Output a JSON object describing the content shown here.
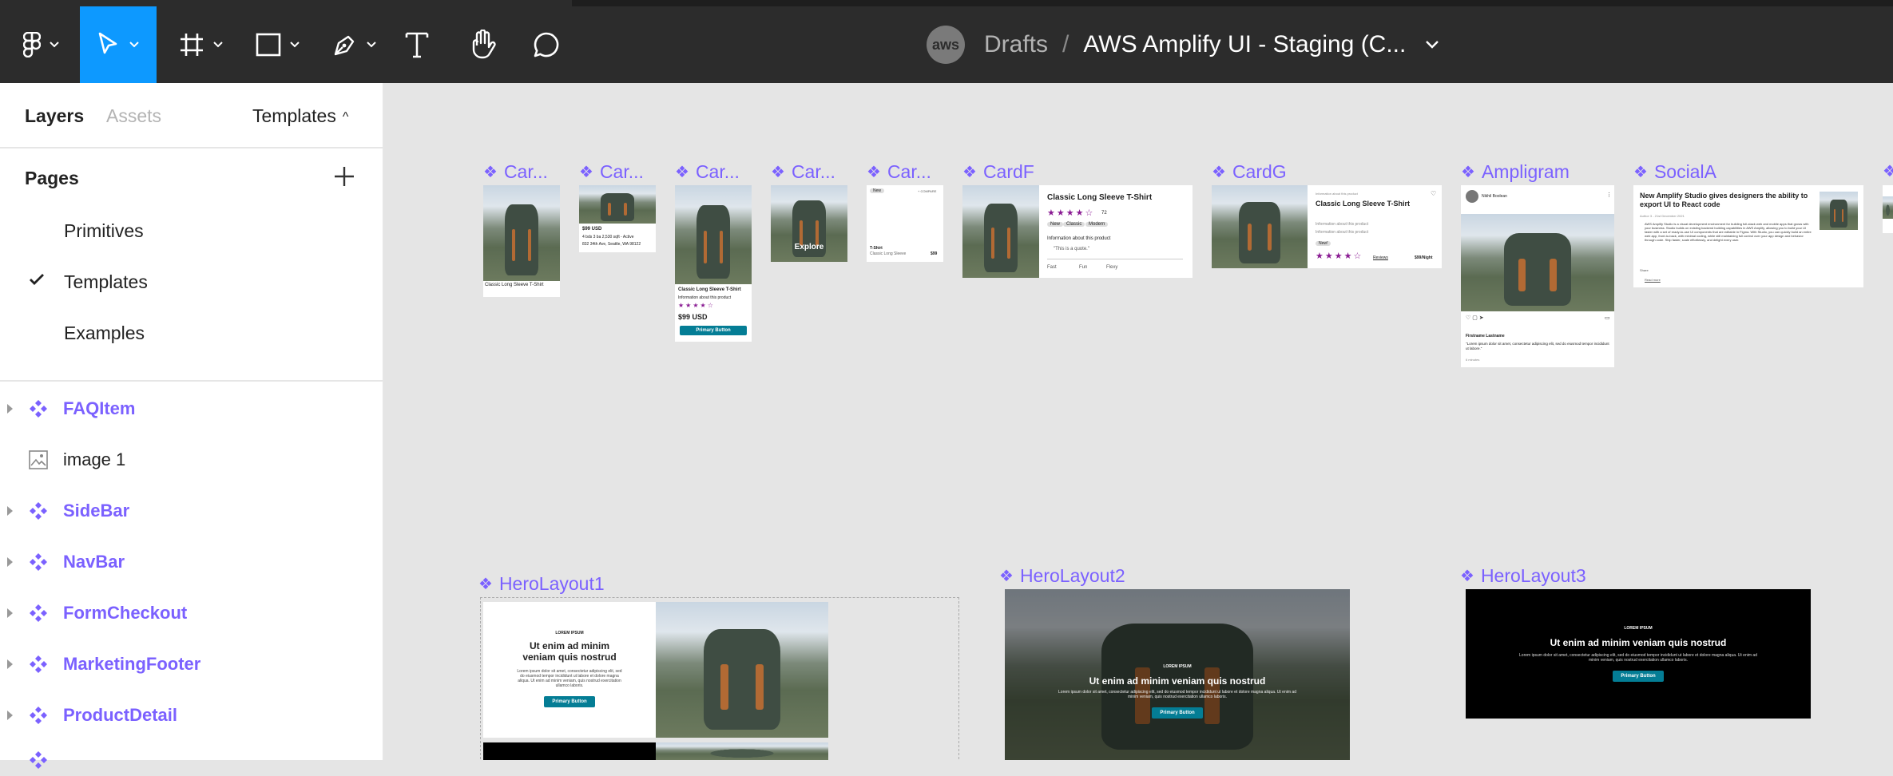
{
  "toolbar": {
    "breadcrumb": {
      "avatar": "aws",
      "project": "Drafts",
      "separator": "/",
      "file": "AWS Amplify UI - Staging (C..."
    }
  },
  "left_panel": {
    "tabs": {
      "layers": "Layers",
      "assets": "Assets",
      "templates": "Templates"
    },
    "pages_header": "Pages",
    "pages": [
      {
        "label": "Primitives"
      },
      {
        "label": "Templates"
      },
      {
        "label": "Examples"
      }
    ],
    "layers": [
      {
        "label": "FAQItem"
      },
      {
        "label": "image 1"
      },
      {
        "label": "SideBar"
      },
      {
        "label": "NavBar"
      },
      {
        "label": "FormCheckout"
      },
      {
        "label": "MarketingFooter"
      },
      {
        "label": "ProductDetail"
      }
    ]
  },
  "canvas": {
    "frame_labels": [
      "Car...",
      "Car...",
      "Car...",
      "Car...",
      "Car...",
      "CardF",
      "CardG",
      "Ampligram",
      "SocialA",
      "HeroLayout1",
      "HeroLayout2",
      "HeroLayout3"
    ],
    "cards": {
      "card_a_title": "Classic Long Sleeve T-Shirt",
      "card_b_price": "$99 USD",
      "card_b_line1": "4 bds 3 ba 2,530 sqft - Active",
      "card_b_line2": "832 34th Ave, Seattle, WA 98122",
      "card_c_title": "Classic Long Sleeve T-Shirt",
      "card_c_info": "Information about this product",
      "card_c_stars": "★★★★☆",
      "card_c_price": "$99 USD",
      "card_c_button": "Primary Button",
      "card_d_button": "Explore",
      "card_e_badge": "New",
      "card_e_compare": "+ COMPARE",
      "card_e_name": "T-Shirt",
      "card_e_sub": "Classic Long Sleeve",
      "card_e_price": "$99",
      "cardf_title": "Classic Long Sleeve T-Shirt",
      "cardf_stars": "★★★★☆",
      "cardf_count": "72",
      "cardf_badges": [
        "New",
        "Classic",
        "Modern"
      ],
      "cardf_info": "Information about this product",
      "cardf_quote": "\"This is a quote.\"",
      "cardf_features": [
        "Fast",
        "Fun",
        "Flexy"
      ],
      "cardg_caption": "Information about this product",
      "cardg_title": "Classic Long Sleeve T-Shirt",
      "cardg_info1": "Information about this product",
      "cardg_info2": "Information about this product",
      "cardg_badge": "New!",
      "cardg_stars": "★★★★☆",
      "cardg_reviews": "Reviews",
      "cardg_price": "$99/Night",
      "ampligram_user": "Nikhil Boolean",
      "ampligram_author": "Firstname Lastname",
      "ampligram_body": "\"Lorem ipsum dolor sit amet, consectetur adipiscing elit, sed do eiusmod tempor incididunt ut labore.\"",
      "ampligram_time": "6 minutes",
      "social_title": "New Amplify Studio gives designers the ability to export UI to React code",
      "social_meta": "Author 3 - 21st December 2021",
      "social_body": "AWS Amplify Studio is a visual development environment for building full-stack web and mobile apps that grows with your business. Studio builds on existing backend building capabilities in AWS Amplify, allowing you to build your UI faster with a set of ready-to-use UI components that are editable in Figma. With Studio, you can quickly build an entire web app, front-to-back, with minimal coding, while still maintaining full control over your app design and behavior through code. Ship faster, scale effortlessly, and delight every user.",
      "social_share": "Share",
      "social_read": "Read more"
    },
    "hero": {
      "eyebrow": "LOREM IPSUM",
      "title": "Ut enim ad minim veniam quis nostrud",
      "body": "Lorem ipsum dolor sit amet, consectetur adipiscing elit, sed do eiusmod tempor incididunt ut labore et dolore magna aliqua. Ut enim ad minim veniam, quis nostrud exercitation ullamco laboris.",
      "button": "Primary Button"
    }
  },
  "colors": {
    "accent": "#0d99ff",
    "component": "#7b61ff",
    "toolbar": "#2c2c2c",
    "canvas": "#e5e5e5",
    "primary_button": "#047d95",
    "stars": "#8a1c93"
  }
}
